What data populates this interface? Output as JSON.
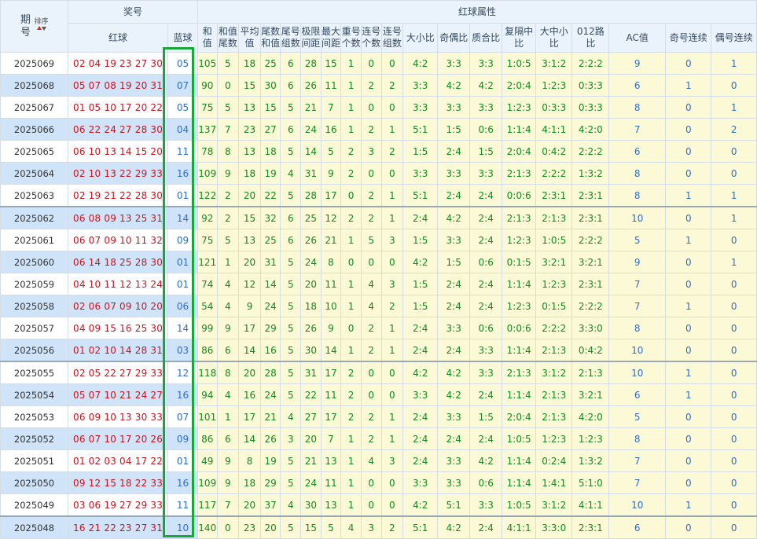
{
  "header": {
    "issue_label": "期号",
    "sort_label": "排序",
    "prize_group": "奖号",
    "red_label": "红球",
    "blue_label": "蓝球",
    "attr_group": "红球属性",
    "attr_columns": [
      "和值",
      "和值尾数",
      "平均值",
      "尾数和值",
      "尾号组数",
      "极限间距",
      "最大间距",
      "重号个数",
      "连号个数",
      "连号组数",
      "大小比",
      "奇偶比",
      "质合比",
      "复隔中比",
      "大中小比",
      "012路比",
      "AC值",
      "奇号连续",
      "偶号连续"
    ]
  },
  "colors": {
    "red_ball": "#c8141e",
    "blue_ball": "#2f6ec6",
    "green_value": "#118a1e",
    "highlight_frame": "#1aa73a"
  },
  "rows": [
    {
      "issue": "2025069",
      "red": "02 04 19 23 27 30",
      "blue": "05",
      "attrs": [
        "105",
        "5",
        "18",
        "25",
        "6",
        "28",
        "15",
        "1",
        "0",
        "0",
        "4:2",
        "3:3",
        "3:3",
        "1:0:5",
        "3:1:2",
        "2:2:2",
        "9",
        "0",
        "1"
      ]
    },
    {
      "issue": "2025068",
      "red": "05 07 08 19 20 31",
      "blue": "07",
      "attrs": [
        "90",
        "0",
        "15",
        "30",
        "6",
        "26",
        "11",
        "1",
        "2",
        "2",
        "3:3",
        "4:2",
        "4:2",
        "2:0:4",
        "1:2:3",
        "0:3:3",
        "6",
        "1",
        "0"
      ]
    },
    {
      "issue": "2025067",
      "red": "01 05 10 17 20 22",
      "blue": "05",
      "attrs": [
        "75",
        "5",
        "13",
        "15",
        "5",
        "21",
        "7",
        "1",
        "0",
        "0",
        "3:3",
        "3:3",
        "3:3",
        "1:2:3",
        "0:3:3",
        "0:3:3",
        "8",
        "0",
        "1"
      ]
    },
    {
      "issue": "2025066",
      "red": "06 22 24 27 28 30",
      "blue": "04",
      "attrs": [
        "137",
        "7",
        "23",
        "27",
        "6",
        "24",
        "16",
        "1",
        "2",
        "1",
        "5:1",
        "1:5",
        "0:6",
        "1:1:4",
        "4:1:1",
        "4:2:0",
        "7",
        "0",
        "2"
      ]
    },
    {
      "issue": "2025065",
      "red": "06 10 13 14 15 20",
      "blue": "11",
      "attrs": [
        "78",
        "8",
        "13",
        "18",
        "5",
        "14",
        "5",
        "2",
        "3",
        "2",
        "1:5",
        "2:4",
        "1:5",
        "2:0:4",
        "0:4:2",
        "2:2:2",
        "6",
        "0",
        "0"
      ]
    },
    {
      "issue": "2025064",
      "red": "02 10 13 22 29 33",
      "blue": "16",
      "attrs": [
        "109",
        "9",
        "18",
        "19",
        "4",
        "31",
        "9",
        "2",
        "0",
        "0",
        "3:3",
        "3:3",
        "3:3",
        "2:1:3",
        "2:2:2",
        "1:3:2",
        "8",
        "0",
        "0"
      ]
    },
    {
      "issue": "2025063",
      "red": "02 19 21 22 28 30",
      "blue": "01",
      "attrs": [
        "122",
        "2",
        "20",
        "22",
        "5",
        "28",
        "17",
        "0",
        "2",
        "1",
        "5:1",
        "2:4",
        "2:4",
        "0:0:6",
        "2:3:1",
        "2:3:1",
        "8",
        "1",
        "1"
      ]
    },
    {
      "issue": "2025062",
      "red": "06 08 09 13 25 31",
      "blue": "14",
      "attrs": [
        "92",
        "2",
        "15",
        "32",
        "6",
        "25",
        "12",
        "2",
        "2",
        "1",
        "2:4",
        "4:2",
        "2:4",
        "2:1:3",
        "2:1:3",
        "2:3:1",
        "10",
        "0",
        "1"
      ]
    },
    {
      "issue": "2025061",
      "red": "06 07 09 10 11 32",
      "blue": "09",
      "attrs": [
        "75",
        "5",
        "13",
        "25",
        "6",
        "26",
        "21",
        "1",
        "5",
        "3",
        "1:5",
        "3:3",
        "2:4",
        "1:2:3",
        "1:0:5",
        "2:2:2",
        "5",
        "1",
        "0"
      ]
    },
    {
      "issue": "2025060",
      "red": "06 14 18 25 28 30",
      "blue": "01",
      "attrs": [
        "121",
        "1",
        "20",
        "31",
        "5",
        "24",
        "8",
        "0",
        "0",
        "0",
        "4:2",
        "1:5",
        "0:6",
        "0:1:5",
        "3:2:1",
        "3:2:1",
        "9",
        "0",
        "1"
      ]
    },
    {
      "issue": "2025059",
      "red": "04 10 11 12 13 24",
      "blue": "01",
      "attrs": [
        "74",
        "4",
        "12",
        "14",
        "5",
        "20",
        "11",
        "1",
        "4",
        "3",
        "1:5",
        "2:4",
        "2:4",
        "1:1:4",
        "1:2:3",
        "2:3:1",
        "7",
        "0",
        "0"
      ]
    },
    {
      "issue": "2025058",
      "red": "02 06 07 09 10 20",
      "blue": "06",
      "attrs": [
        "54",
        "4",
        "9",
        "24",
        "5",
        "18",
        "10",
        "1",
        "4",
        "2",
        "1:5",
        "2:4",
        "2:4",
        "1:2:3",
        "0:1:5",
        "2:2:2",
        "7",
        "1",
        "0"
      ]
    },
    {
      "issue": "2025057",
      "red": "04 09 15 16 25 30",
      "blue": "14",
      "attrs": [
        "99",
        "9",
        "17",
        "29",
        "5",
        "26",
        "9",
        "0",
        "2",
        "1",
        "2:4",
        "3:3",
        "0:6",
        "0:0:6",
        "2:2:2",
        "3:3:0",
        "8",
        "0",
        "0"
      ]
    },
    {
      "issue": "2025056",
      "red": "01 02 10 14 28 31",
      "blue": "03",
      "attrs": [
        "86",
        "6",
        "14",
        "16",
        "5",
        "30",
        "14",
        "1",
        "2",
        "1",
        "2:4",
        "2:4",
        "3:3",
        "1:1:4",
        "2:1:3",
        "0:4:2",
        "10",
        "0",
        "0"
      ]
    },
    {
      "issue": "2025055",
      "red": "02 05 22 27 29 33",
      "blue": "12",
      "attrs": [
        "118",
        "8",
        "20",
        "28",
        "5",
        "31",
        "17",
        "2",
        "0",
        "0",
        "4:2",
        "4:2",
        "3:3",
        "2:1:3",
        "3:1:2",
        "2:1:3",
        "10",
        "1",
        "0"
      ]
    },
    {
      "issue": "2025054",
      "red": "05 07 10 21 24 27",
      "blue": "16",
      "attrs": [
        "94",
        "4",
        "16",
        "24",
        "5",
        "22",
        "11",
        "2",
        "0",
        "0",
        "3:3",
        "4:2",
        "2:4",
        "1:1:4",
        "2:1:3",
        "3:2:1",
        "6",
        "1",
        "0"
      ]
    },
    {
      "issue": "2025053",
      "red": "06 09 10 13 30 33",
      "blue": "07",
      "attrs": [
        "101",
        "1",
        "17",
        "21",
        "4",
        "27",
        "17",
        "2",
        "2",
        "1",
        "2:4",
        "3:3",
        "1:5",
        "2:0:4",
        "2:1:3",
        "4:2:0",
        "5",
        "0",
        "0"
      ]
    },
    {
      "issue": "2025052",
      "red": "06 07 10 17 20 26",
      "blue": "09",
      "attrs": [
        "86",
        "6",
        "14",
        "26",
        "3",
        "20",
        "7",
        "1",
        "2",
        "1",
        "2:4",
        "2:4",
        "2:4",
        "1:0:5",
        "1:2:3",
        "1:2:3",
        "8",
        "0",
        "0"
      ]
    },
    {
      "issue": "2025051",
      "red": "01 02 03 04 17 22",
      "blue": "01",
      "attrs": [
        "49",
        "9",
        "8",
        "19",
        "5",
        "21",
        "13",
        "1",
        "4",
        "3",
        "2:4",
        "3:3",
        "4:2",
        "1:1:4",
        "0:2:4",
        "1:3:2",
        "7",
        "0",
        "0"
      ]
    },
    {
      "issue": "2025050",
      "red": "09 12 15 18 22 33",
      "blue": "16",
      "attrs": [
        "109",
        "9",
        "18",
        "29",
        "5",
        "24",
        "11",
        "1",
        "0",
        "0",
        "3:3",
        "3:3",
        "0:6",
        "1:1:4",
        "1:4:1",
        "5:1:0",
        "7",
        "0",
        "0"
      ]
    },
    {
      "issue": "2025049",
      "red": "03 06 19 27 29 33",
      "blue": "11",
      "attrs": [
        "117",
        "7",
        "20",
        "37",
        "4",
        "30",
        "13",
        "1",
        "0",
        "0",
        "4:2",
        "5:1",
        "3:3",
        "1:0:5",
        "3:1:2",
        "4:1:1",
        "10",
        "1",
        "0"
      ]
    },
    {
      "issue": "2025048",
      "red": "16 21 22 23 27 31",
      "blue": "10",
      "attrs": [
        "140",
        "0",
        "23",
        "20",
        "5",
        "15",
        "5",
        "4",
        "3",
        "2",
        "5:1",
        "4:2",
        "2:4",
        "4:1:1",
        "3:3:0",
        "2:3:1",
        "6",
        "0",
        "0"
      ]
    }
  ]
}
